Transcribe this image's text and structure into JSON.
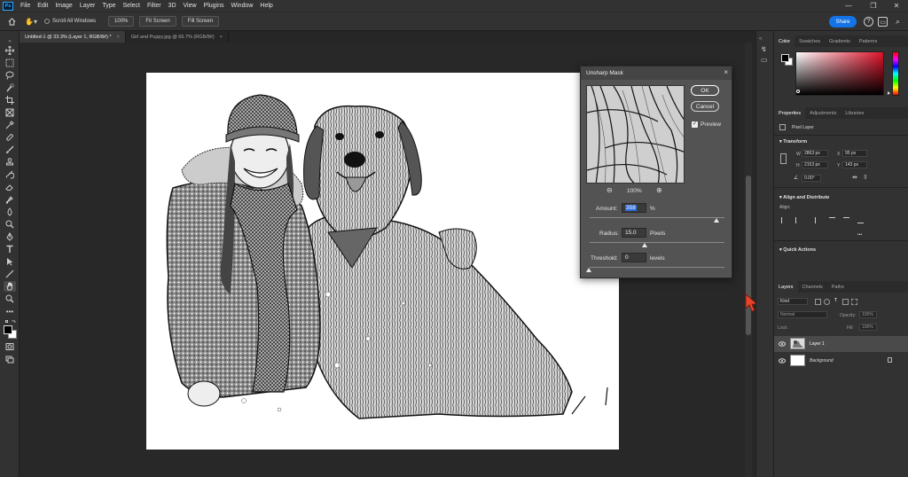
{
  "app": {
    "logo": "Ps",
    "menu": [
      "File",
      "Edit",
      "Image",
      "Layer",
      "Type",
      "Select",
      "Filter",
      "3D",
      "View",
      "Plugins",
      "Window",
      "Help"
    ]
  },
  "options_bar": {
    "scroll_all_windows": "Scroll All Windows",
    "zoom_100": "100%",
    "fit_screen": "Fit Screen",
    "fill_screen": "Fill Screen",
    "share": "Share"
  },
  "tabs": [
    {
      "label": "Untitled-1 @ 33.3% (Layer 1, RGB/8#) *",
      "close": "×"
    },
    {
      "label": "Girl and Puppy.jpg @ 66.7% (RGB/8#)",
      "close": "×"
    }
  ],
  "dialog": {
    "title": "Unsharp Mask",
    "close": "×",
    "ok": "OK",
    "cancel": "Cancel",
    "preview_label": "Preview",
    "preview_checked": "✓",
    "zoom_level": "100%",
    "amount_label": "Amount:",
    "amount_value": "358",
    "amount_unit": "%",
    "radius_label": "Radius:",
    "radius_value": "15.0",
    "radius_unit": "Pixels",
    "threshold_label": "Threshold:",
    "threshold_value": "0",
    "threshold_unit": "levels"
  },
  "color_panel": {
    "tabs": [
      "Color",
      "Swatches",
      "Gradients",
      "Patterns"
    ],
    "hue_color": "#e0122a"
  },
  "properties_panel": {
    "tabs": [
      "Properties",
      "Adjustments",
      "Libraries"
    ],
    "layer_type": "Pixel Layer",
    "transform_heading": "Transform",
    "w_label": "W",
    "w_value": "2863 px",
    "x_label": "X",
    "x_value": "95 px",
    "h_label": "H",
    "h_value": "2153 px",
    "y_label": "Y",
    "y_value": "143 px",
    "angle_value": "0.00°",
    "align_heading": "Align and Distribute",
    "align_label": "Align:",
    "more": "•••",
    "quick_actions_heading": "Quick Actions"
  },
  "layers_panel": {
    "tabs": [
      "Layers",
      "Channels",
      "Paths"
    ],
    "search_placeholder": "Kind",
    "blend_mode": "Normal",
    "opacity_label": "Opacity:",
    "opacity_value": "100%",
    "lock_label": "Lock:",
    "fill_label": "Fill:",
    "fill_value": "100%",
    "layers": [
      {
        "name": "Layer 1"
      },
      {
        "name": "Background"
      }
    ]
  }
}
